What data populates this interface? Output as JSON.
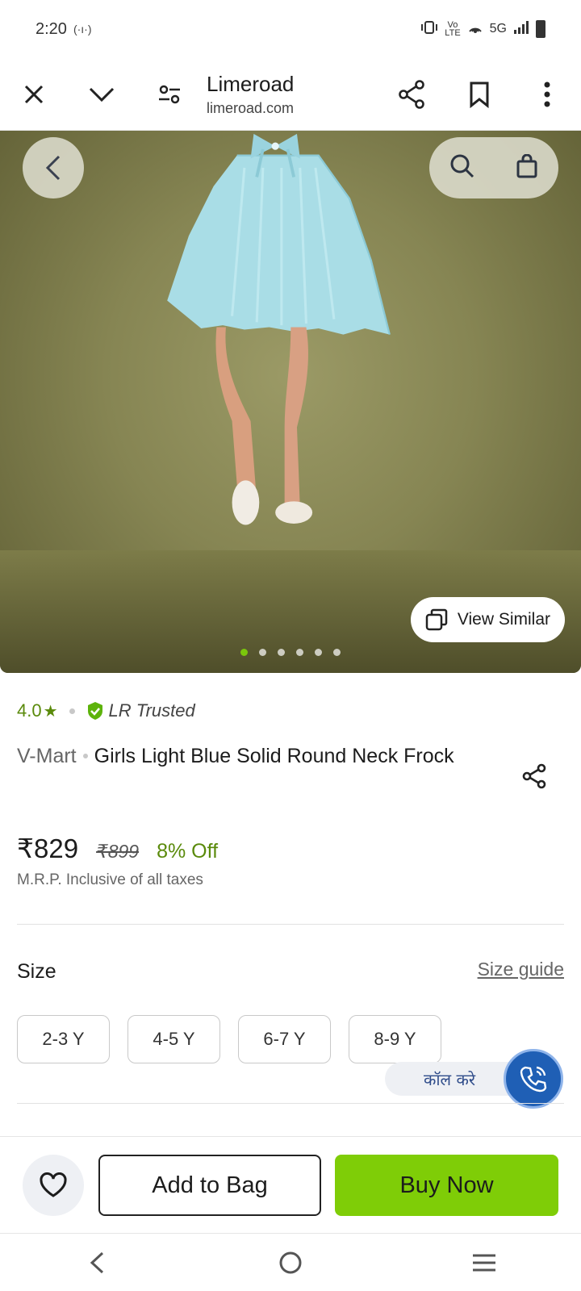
{
  "status_bar": {
    "time": "2:20",
    "hotspot_icon_text": "(·ı·)",
    "right_indicators": "5G"
  },
  "browser": {
    "site_title": "Limeroad",
    "site_url": "limeroad.com"
  },
  "hero": {
    "view_similar_label": "View Similar",
    "image_count": 6,
    "active_image_index": 0
  },
  "product": {
    "rating": "4.0",
    "rating_star": "★",
    "trusted_label": "LR Trusted",
    "brand": "V-Mart",
    "title": "Girls Light Blue Solid Round Neck Frock",
    "price": "₹829",
    "mrp": "₹899",
    "discount": "8% Off",
    "tax_note": "M.R.P. Inclusive of all taxes"
  },
  "size_section": {
    "label": "Size",
    "guide_label": "Size guide",
    "options": [
      "2-3 Y",
      "4-5 Y",
      "6-7 Y",
      "8-9 Y"
    ]
  },
  "call": {
    "label": "कॉल करे"
  },
  "actions": {
    "add_to_bag": "Add to Bag",
    "buy_now": "Buy Now"
  },
  "colors": {
    "accent_green": "#7fcd07",
    "rating_green": "#5a8a0b",
    "call_blue": "#1f5fb5"
  },
  "icons": [
    "close-icon",
    "chevron-down-icon",
    "tune-icon",
    "share-icon",
    "bookmark-icon",
    "more-vert-icon",
    "back-icon",
    "search-icon",
    "bag-icon",
    "copy-icon",
    "shield-check-icon",
    "heart-icon",
    "phone-icon",
    "nav-back-icon",
    "nav-home-icon",
    "nav-recents-icon"
  ]
}
